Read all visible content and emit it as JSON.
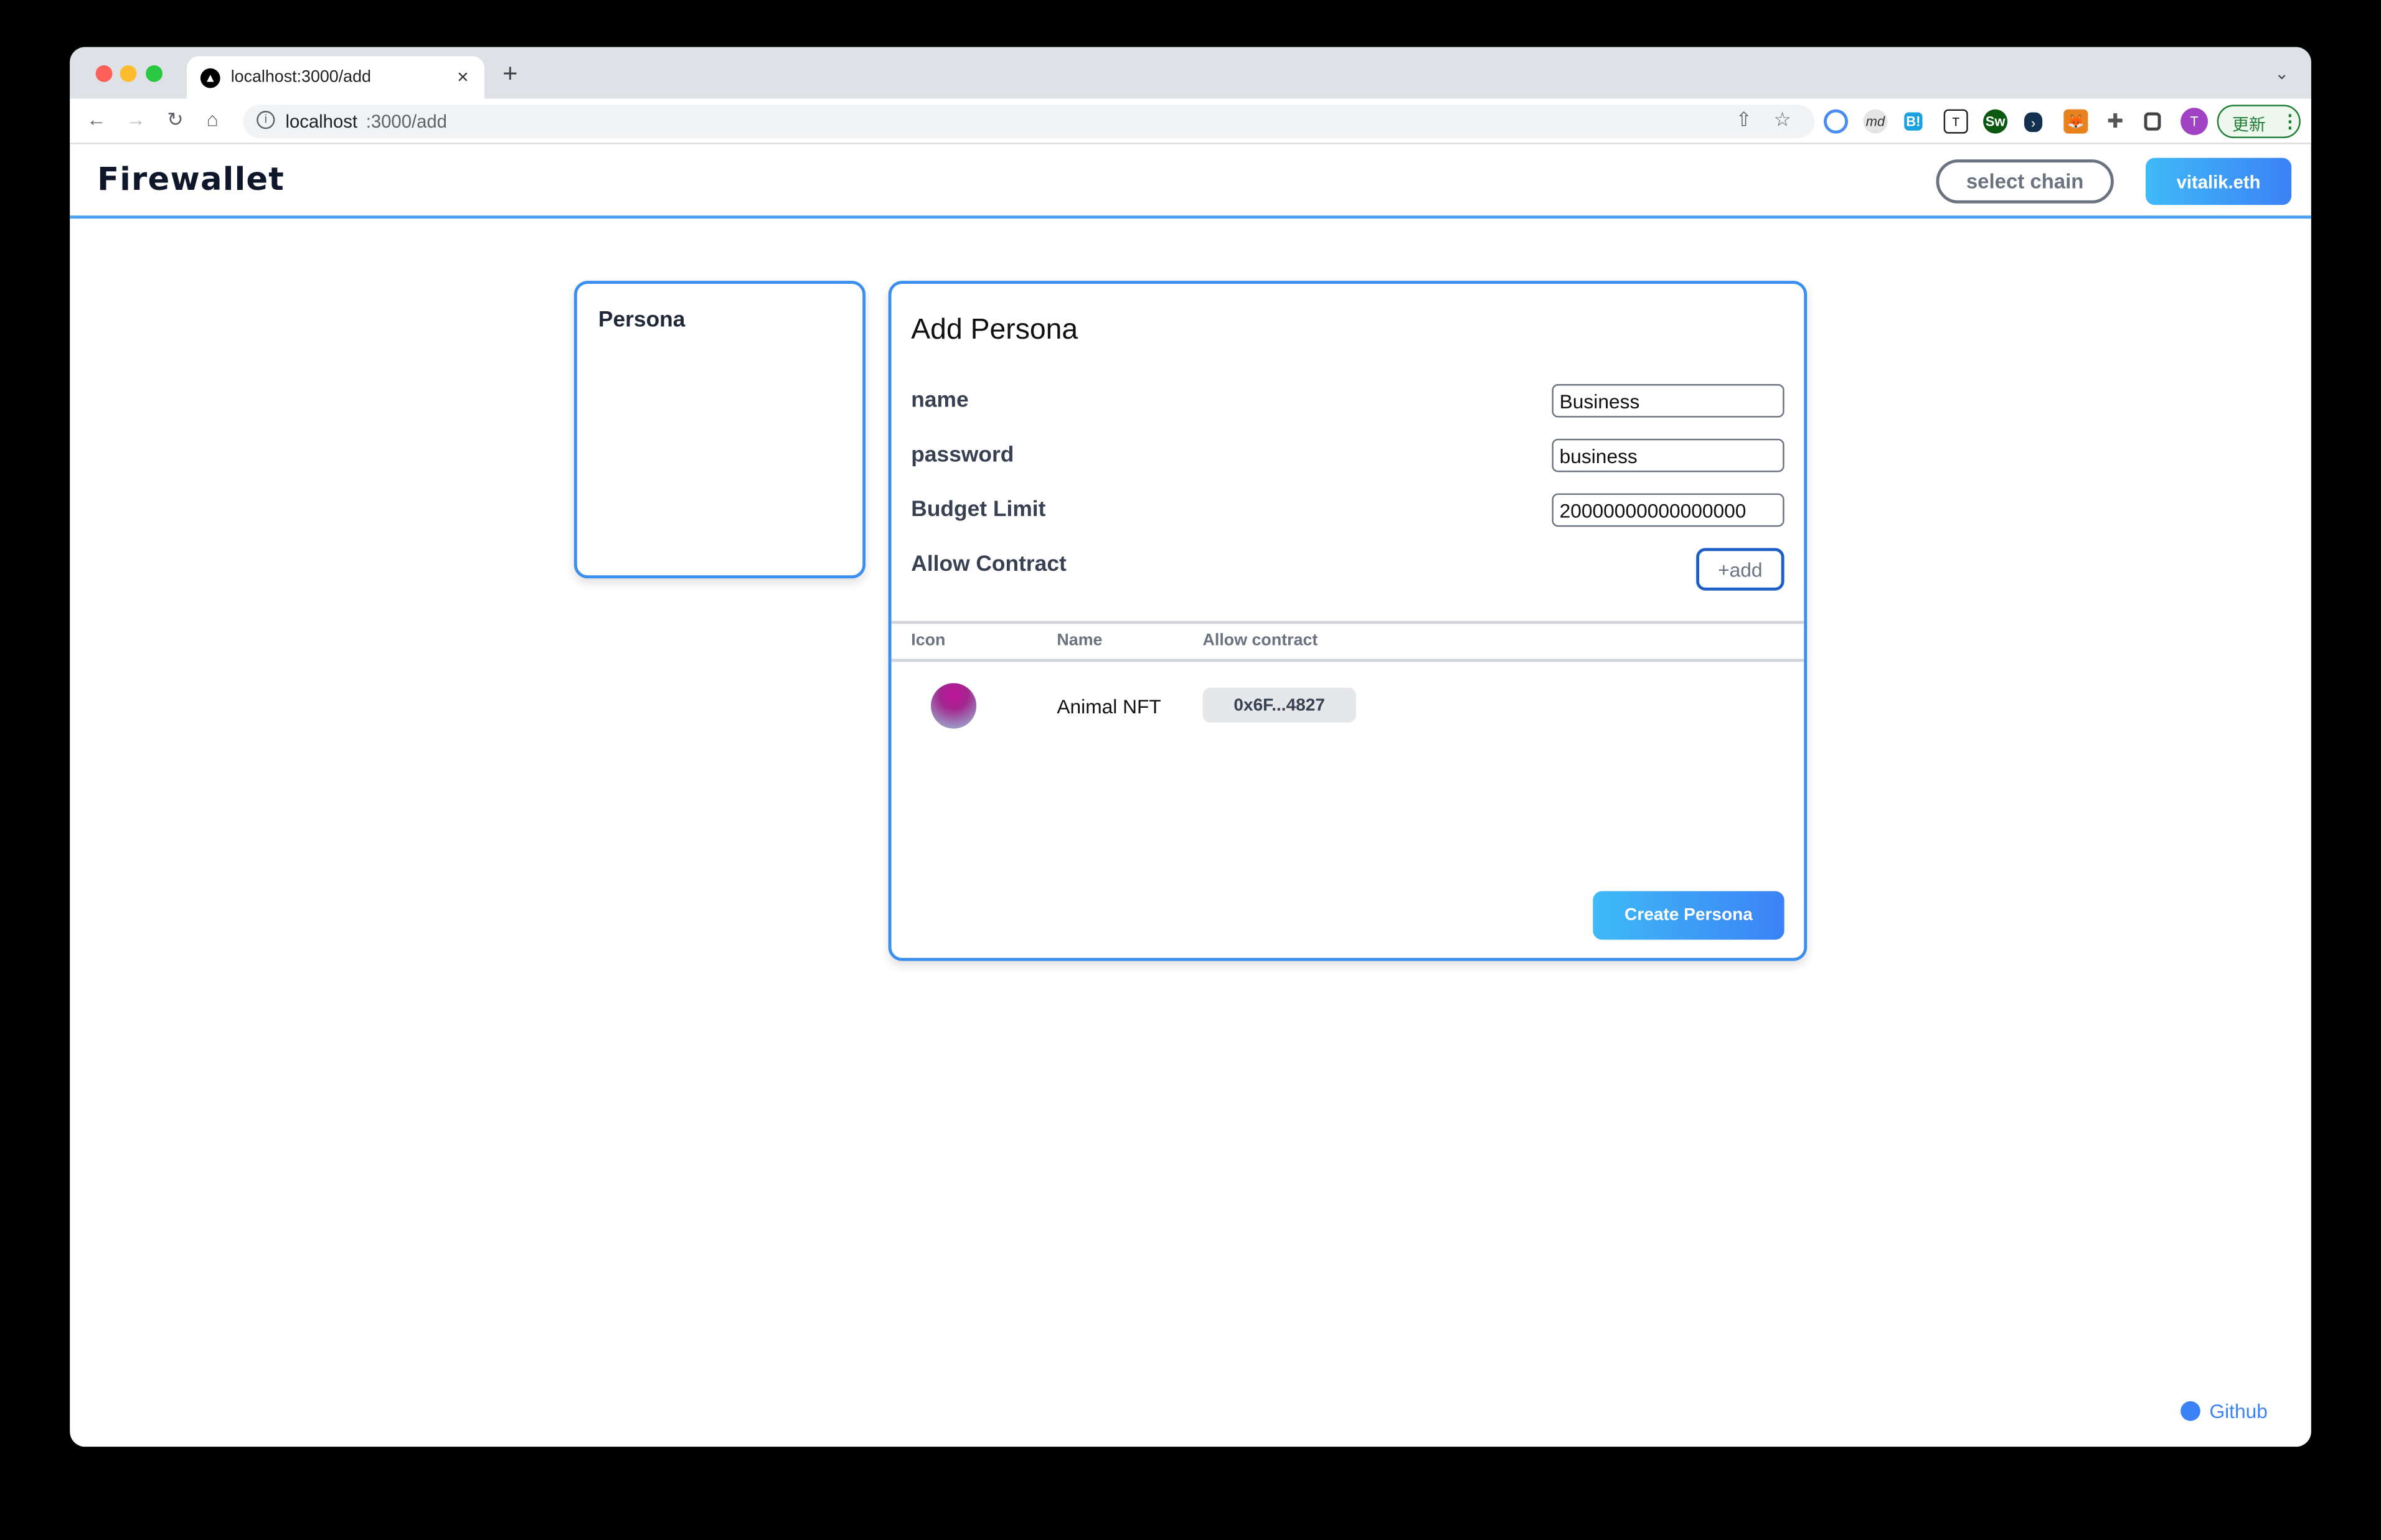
{
  "browser": {
    "tab_title": "localhost:3000/add",
    "url_host": "localhost",
    "url_rest": ":3000/add",
    "update_label": "更新",
    "profile_initial": "T",
    "extensions": [
      "password-manager-icon",
      "md-icon",
      "hatena-bookmark-icon",
      "trash-icon",
      "sw-icon",
      "dev-extension-icon",
      "metamask-fox-icon",
      "puzzle-icon",
      "sidepanel-icon"
    ]
  },
  "app": {
    "logo": "Firewallet",
    "select_chain_label": "select chain",
    "account_label": "vitalik.eth",
    "accent": "#3b82f6"
  },
  "sidebar": {
    "title": "Persona"
  },
  "form": {
    "title": "Add Persona",
    "fields": [
      {
        "label": "name",
        "value": "Business"
      },
      {
        "label": "password",
        "value": "business"
      },
      {
        "label": "Budget Limit",
        "value": "20000000000000000"
      }
    ],
    "allow_contract_label": "Allow Contract",
    "add_label": "+add",
    "table": {
      "headers": [
        "Icon",
        "Name",
        "Allow contract"
      ],
      "rows": [
        {
          "name": "Animal NFT",
          "address": "0x6F...4827"
        }
      ]
    },
    "submit_label": "Create Persona"
  },
  "footer": {
    "github_label": "Github"
  }
}
